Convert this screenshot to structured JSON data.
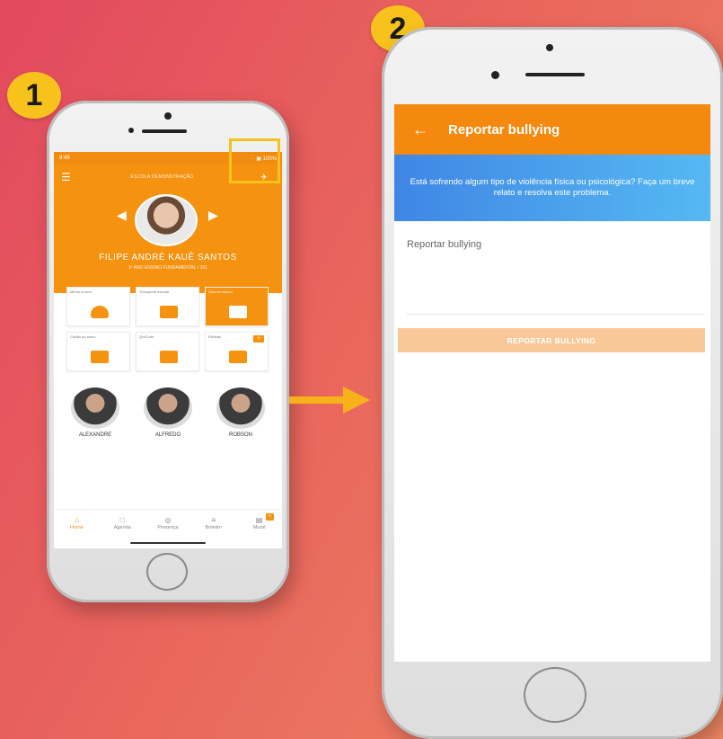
{
  "badges": {
    "step1": "1",
    "step2": "2"
  },
  "colors": {
    "primary": "#f5920f",
    "accent_badge": "#f7c21c",
    "banner_start": "#3f86e4",
    "banner_end": "#56b9f3"
  },
  "screen1": {
    "status": {
      "time": "9:49",
      "icons": "· · ▣ 100%"
    },
    "appbar": {
      "school": "ESCOLA DEMONSTRAÇÃO",
      "menu_icon": "☰",
      "action_icon": "✈"
    },
    "student": {
      "name": "FILIPE ANDRÉ KAUÊ SANTOS",
      "grade": "1º ANO ENSINO FUNDAMENTAL / 101"
    },
    "tiles": [
      {
        "label": "Minha nuvem",
        "icon": "cloud-icon"
      },
      {
        "label": "Transporte escolar",
        "icon": "bus-icon"
      },
      {
        "label": "Sala de estudo",
        "icon": "book-icon"
      },
      {
        "label": "Cartão do aluno",
        "icon": "id-card-icon"
      },
      {
        "label": "QrdCode",
        "icon": "qr-code-icon"
      },
      {
        "label": "Eletivas",
        "icon": "list-icon"
      }
    ],
    "people": [
      {
        "name": "ALEXANDRE"
      },
      {
        "name": "ALFREDO"
      },
      {
        "name": "ROBSON"
      }
    ],
    "nav": [
      {
        "label": "Home",
        "icon": "⌂"
      },
      {
        "label": "Agenda",
        "icon": "□"
      },
      {
        "label": "Presença",
        "icon": "◎"
      },
      {
        "label": "Boletim",
        "icon": "≡"
      },
      {
        "label": "Mural",
        "icon": "▤"
      }
    ]
  },
  "screen2": {
    "appbar": {
      "back_icon": "←",
      "title": "Reportar bullying"
    },
    "banner": "Está sofrendo algum tipo de violência física ou psicológica? Faça um breve relato e resolva este problema.",
    "field_placeholder": "Reportar bullying",
    "submit_label": "REPORTAR BULLYING"
  }
}
